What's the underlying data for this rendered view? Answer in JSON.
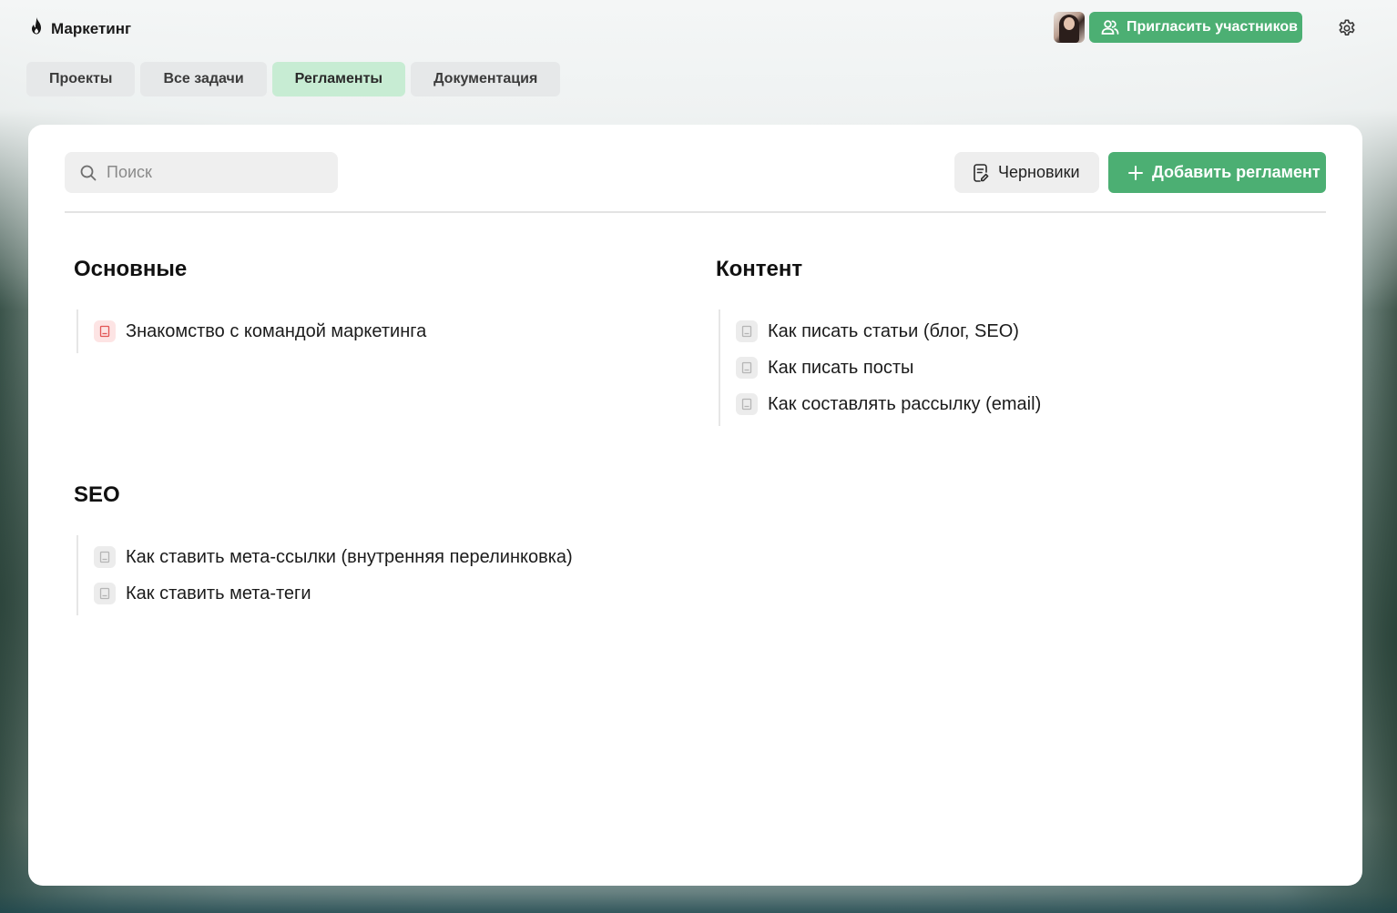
{
  "app": {
    "workspace_name": "Маркетинг",
    "workspace_icon": "flame-icon",
    "invite_label": "Пригласить участников",
    "accent_color": "#4caf73"
  },
  "tabs": [
    {
      "label": "Проекты",
      "active": false
    },
    {
      "label": "Все задачи",
      "active": false
    },
    {
      "label": "Регламенты",
      "active": true
    },
    {
      "label": "Документация",
      "active": false
    }
  ],
  "toolbar": {
    "search_placeholder": "Поиск",
    "search_value": "",
    "drafts_label": "Черновики",
    "add_label": "Добавить регламент"
  },
  "sections": [
    {
      "title": "Основные",
      "items": [
        {
          "label": "Знакомство с командой маркетинга",
          "icon": "document-icon",
          "icon_color": "#e25555"
        }
      ]
    },
    {
      "title": "Контент",
      "items": [
        {
          "label": "Как писать статьи (блог, SEO)",
          "icon": "document-icon",
          "icon_color": "#b5b5b5"
        },
        {
          "label": "Как писать посты",
          "icon": "document-icon",
          "icon_color": "#b5b5b5"
        },
        {
          "label": "Как составлять рассылку (email)",
          "icon": "document-icon",
          "icon_color": "#b5b5b5"
        }
      ]
    },
    {
      "title": "SEO",
      "items": [
        {
          "label": "Как ставить мета-ссылки (внутренняя перелинковка)",
          "icon": "document-icon",
          "icon_color": "#b5b5b5"
        },
        {
          "label": "Как ставить мета-теги",
          "icon": "document-icon",
          "icon_color": "#b5b5b5"
        }
      ]
    }
  ]
}
